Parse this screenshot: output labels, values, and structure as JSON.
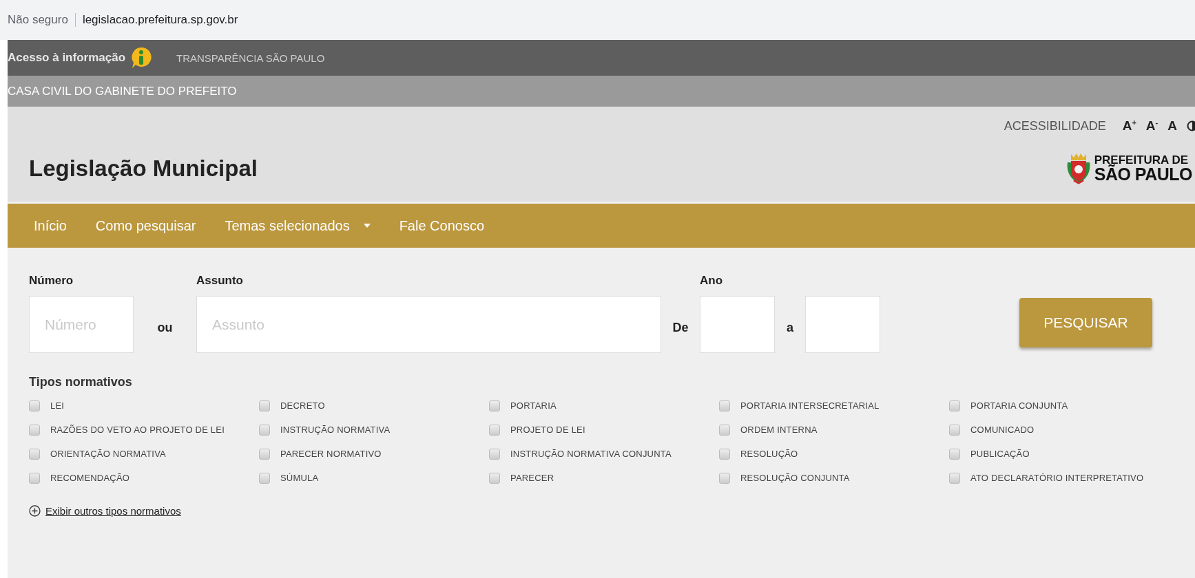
{
  "address_bar": {
    "security": "Não seguro",
    "url": "legislacao.prefeitura.sp.gov.br"
  },
  "top_bar": {
    "access_label": "Acesso à informação",
    "transparency_link": "TRANSPARÊNCIA SÃO PAULO"
  },
  "sub_bar": {
    "title": "CASA CIVIL DO GABINETE DO PREFEITO"
  },
  "accessibility": {
    "label": "ACESSIBILIDADE",
    "buttons": [
      "A$^{+}$",
      "A$^{-}$",
      "A"
    ]
  },
  "header": {
    "title": "Legislação Municipal",
    "logo_lines": [
      "PREFEITURA DE",
      "SÃO PAULO"
    ]
  },
  "nav": [
    {
      "label": "Início",
      "dropdown": false
    },
    {
      "label": "Como pesquisar",
      "dropdown": false
    },
    {
      "label": "Temas selecionados",
      "dropdown": true
    },
    {
      "label": "Fale Conosco",
      "dropdown": false
    }
  ],
  "search": {
    "numero_label": "Número",
    "numero_placeholder": "Número",
    "or_text": "ou",
    "assunto_label": "Assunto",
    "assunto_placeholder": "Assunto",
    "ano_label": "Ano",
    "from_text": "De",
    "to_text": "a",
    "button": "PESQUISAR"
  },
  "types": {
    "title": "Tipos normativos",
    "items": [
      {
        "label": "LEI",
        "checked": false
      },
      {
        "label": "DECRETO",
        "checked": false
      },
      {
        "label": "PORTARIA",
        "checked": false
      },
      {
        "label": "PORTARIA INTERSECRETARIAL",
        "checked": false
      },
      {
        "label": "PORTARIA CONJUNTA",
        "checked": false
      },
      {
        "label": "RAZÕES DO VETO AO PROJETO DE LEI",
        "checked": false
      },
      {
        "label": "INSTRUÇÃO NORMATIVA",
        "checked": false
      },
      {
        "label": "PROJETO DE LEI",
        "checked": false
      },
      {
        "label": "ORDEM INTERNA",
        "checked": false
      },
      {
        "label": "COMUNICADO",
        "checked": false
      },
      {
        "label": "ORIENTAÇÃO NORMATIVA",
        "checked": false
      },
      {
        "label": "PARECER NORMATIVO",
        "checked": false
      },
      {
        "label": "INSTRUÇÃO NORMATIVA CONJUNTA",
        "checked": false
      },
      {
        "label": "RESOLUÇÃO",
        "checked": false
      },
      {
        "label": "PUBLICAÇÃO",
        "checked": false
      },
      {
        "label": "RECOMENDAÇÃO",
        "checked": false
      },
      {
        "label": "SÚMULA",
        "checked": false
      },
      {
        "label": "PARECER",
        "checked": false
      },
      {
        "label": "RESOLUÇÃO CONJUNTA",
        "checked": false
      },
      {
        "label": "ATO DECLARATÓRIO INTERPRETATIVO",
        "checked": false
      }
    ],
    "more_link": "Exibir outros tipos normativos"
  }
}
